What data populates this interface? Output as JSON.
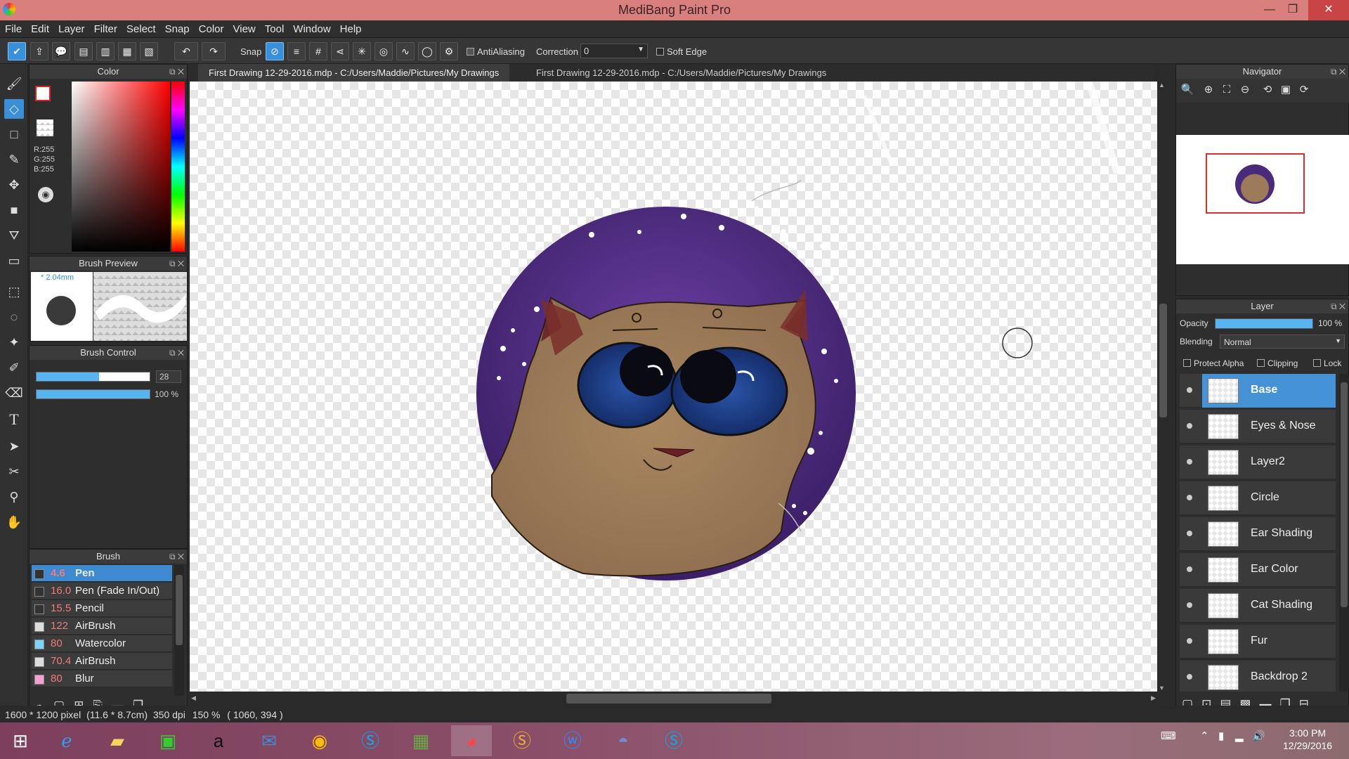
{
  "window": {
    "title": "MediBang Paint Pro",
    "minimize": "—",
    "maximize": "❐",
    "close": "✕"
  },
  "menu": [
    "File",
    "Edit",
    "Layer",
    "Filter",
    "Select",
    "Snap",
    "Color",
    "View",
    "Tool",
    "Window",
    "Help"
  ],
  "toolbar": {
    "snap_label": "Snap",
    "antialiasing_label": "AntiAliasing",
    "correction_label": "Correction",
    "correction_value": "0",
    "soft_edge_label": "Soft Edge",
    "antialiasing_checked": true,
    "soft_edge_checked": false
  },
  "panels": {
    "color": {
      "title": "Color",
      "r": "R:255",
      "g": "G:255",
      "b": "B:255",
      "primary": "#ffffff",
      "primary_border": "#e02020"
    },
    "brush_preview": {
      "title": "Brush Preview",
      "size": "* 2.04mm"
    },
    "brush_control": {
      "title": "Brush Control",
      "size_value": "28",
      "size_fraction": 0.55,
      "opacity_value": "100 %",
      "opacity_fraction": 1.0
    },
    "brush": {
      "title": "Brush",
      "items": [
        {
          "size": "4.6",
          "name": "Pen",
          "swatch": "#333333",
          "selected": true
        },
        {
          "size": "16.0",
          "name": "Pen (Fade In/Out)",
          "swatch": "#333333"
        },
        {
          "size": "15.5",
          "name": "Pencil",
          "swatch": "#333333"
        },
        {
          "size": "122",
          "name": "AirBrush",
          "swatch": "#dddddd"
        },
        {
          "size": "80",
          "name": "Watercolor",
          "swatch": "#7fd3f5"
        },
        {
          "size": "70.4",
          "name": "AirBrush",
          "swatch": "#dddddd"
        },
        {
          "size": "80",
          "name": "Blur",
          "swatch": "#f5a0d0"
        }
      ]
    }
  },
  "tabs": [
    {
      "label": "First Drawing 12-29-2016.mdp - C:/Users/Maddie/Pictures/My Drawings",
      "active": true
    },
    {
      "label": "First Drawing 12-29-2016.mdp - C:/Users/Maddie/Pictures/My Drawings",
      "active": false
    }
  ],
  "navigator": {
    "title": "Navigator"
  },
  "layer": {
    "title": "Layer",
    "opacity_label": "Opacity",
    "opacity_value": "100 %",
    "opacity_fraction": 1.0,
    "blending_label": "Blending",
    "blending_value": "Normal",
    "protect_alpha": "Protect Alpha",
    "clipping": "Clipping",
    "lock": "Lock",
    "layers": [
      "Base",
      "Eyes & Nose",
      "Layer2",
      "Circle",
      "Ear Shading",
      "Ear Color",
      "Cat Shading",
      "Fur",
      "Backdrop 2"
    ]
  },
  "status": {
    "size": "1600 * 1200 pixel",
    "cm": "(11.6 * 8.7cm)",
    "dpi": "350 dpi",
    "zoom": "150 %",
    "coords": "( 1060, 394 )"
  },
  "taskbar": {
    "time": "3:00 PM",
    "date": "12/29/2016"
  },
  "colors": {
    "accent": "#3a8fd9",
    "titlebar": "#d97f7d",
    "galaxy": "#4a2a7a",
    "fur": "#9c7a5a",
    "eye": "#1e3f86"
  }
}
